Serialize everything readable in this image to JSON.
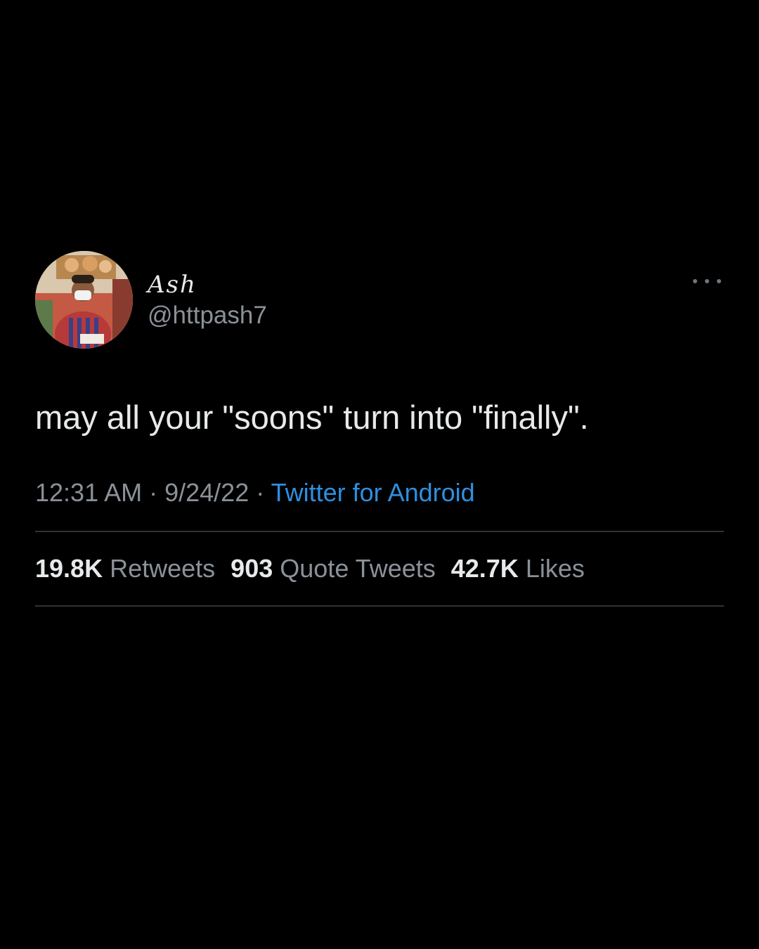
{
  "tweet": {
    "author": {
      "display_name": "Ash",
      "handle": "@httpash7",
      "avatar_icon": "profile-photo"
    },
    "more_icon": "more-options-icon",
    "text": "may all your \"soons\" turn into \"finally\".",
    "meta": {
      "time": "12:31 AM",
      "separator": " · ",
      "date": "9/24/22",
      "source": "Twitter for Android"
    },
    "stats": [
      {
        "count": "19.8K",
        "label": "Retweets"
      },
      {
        "count": "903",
        "label": "Quote Tweets"
      },
      {
        "count": "42.7K",
        "label": "Likes"
      }
    ]
  },
  "colors": {
    "background": "#000000",
    "text_primary": "#e7e9ea",
    "text_secondary": "#8b9198",
    "link": "#2f8fe0",
    "divider": "#2f3336"
  }
}
